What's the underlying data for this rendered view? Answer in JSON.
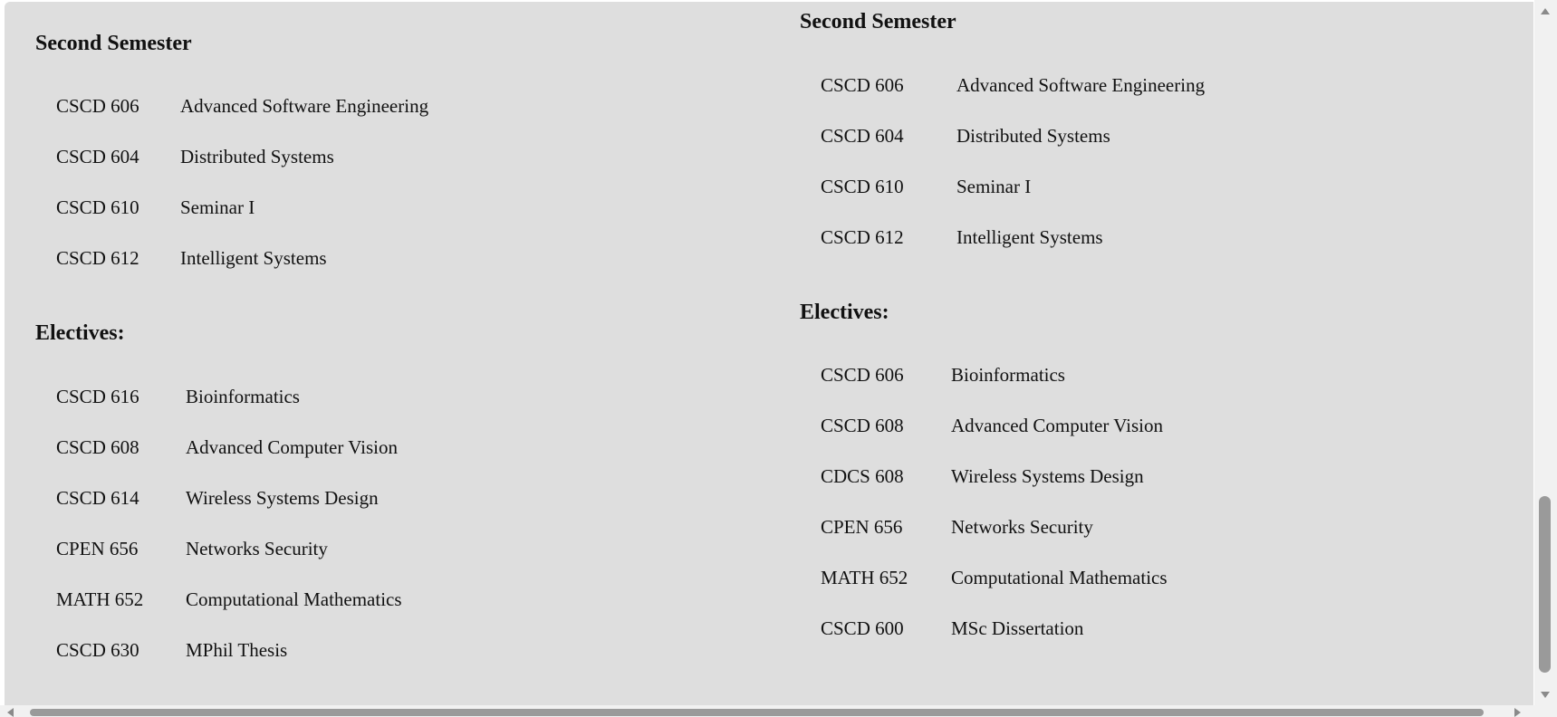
{
  "left_column": {
    "second_semester": {
      "heading": "Second Semester",
      "courses": [
        {
          "code": "CSCD 606",
          "title": "Advanced Software Engineering"
        },
        {
          "code": "CSCD 604",
          "title": "Distributed Systems"
        },
        {
          "code": "CSCD 610",
          "title": "Seminar I"
        },
        {
          "code": "CSCD 612",
          "title": "Intelligent Systems"
        }
      ]
    },
    "electives": {
      "heading": "Electives:",
      "courses": [
        {
          "code": "CSCD 616",
          "title": "Bioinformatics"
        },
        {
          "code": "CSCD 608",
          "title": "Advanced Computer Vision"
        },
        {
          "code": "CSCD 614",
          "title": "Wireless Systems Design"
        },
        {
          "code": "CPEN 656",
          "title": "Networks Security"
        },
        {
          "code": "MATH 652",
          "title": "Computational Mathematics"
        },
        {
          "code": "CSCD 630",
          "title": "MPhil Thesis"
        }
      ]
    }
  },
  "right_column": {
    "second_semester": {
      "heading": "Second Semester",
      "courses": [
        {
          "code": "CSCD 606",
          "title": "Advanced Software Engineering"
        },
        {
          "code": "CSCD 604",
          "title": "Distributed Systems"
        },
        {
          "code": "CSCD 610",
          "title": "Seminar I"
        },
        {
          "code": "CSCD 612",
          "title": "Intelligent Systems"
        }
      ]
    },
    "electives": {
      "heading": "Electives:",
      "courses": [
        {
          "code": "CSCD 606",
          "title": "Bioinformatics"
        },
        {
          "code": "CSCD 608",
          "title": "Advanced Computer Vision"
        },
        {
          "code": "CDCS 608",
          "title": "Wireless Systems Design"
        },
        {
          "code": "CPEN 656",
          "title": "Networks Security"
        },
        {
          "code": "MATH 652",
          "title": "Computational Mathematics"
        },
        {
          "code": "CSCD 600",
          "title": "MSc Dissertation"
        }
      ]
    }
  },
  "scrollbar_icons": {
    "up": "arrow-up-icon",
    "down": "arrow-down-icon",
    "left": "arrow-left-icon",
    "right": "arrow-right-icon"
  },
  "colors": {
    "page_background": "#dedede",
    "text": "#111111",
    "scrollbar_track": "#f1f1f1",
    "scrollbar_thumb": "#9a9a9a"
  }
}
